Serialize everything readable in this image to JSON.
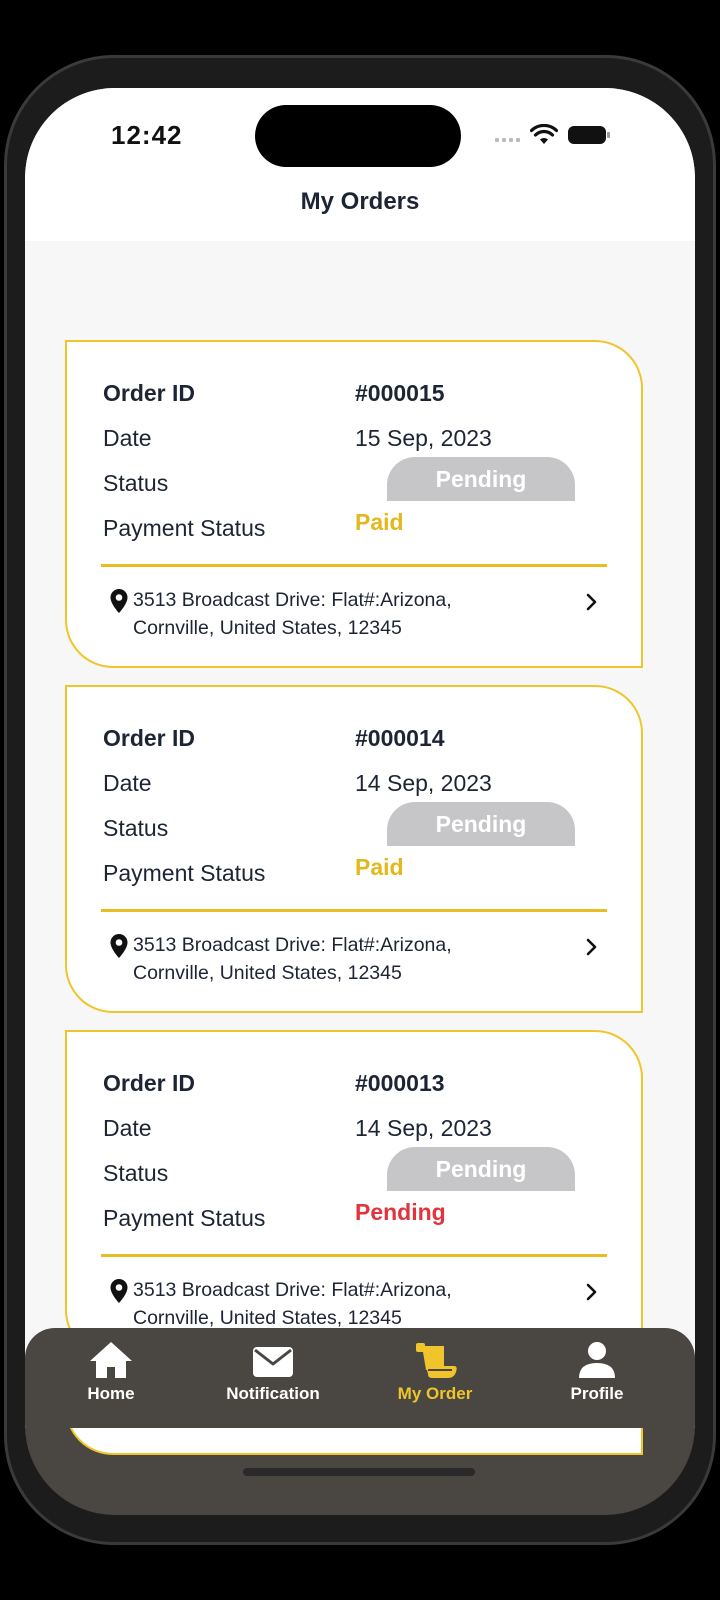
{
  "status_bar": {
    "time": "12:42"
  },
  "header": {
    "title": "My Orders"
  },
  "labels": {
    "order_id": "Order ID",
    "date": "Date",
    "status": "Status",
    "payment_status": "Payment Status"
  },
  "orders": [
    {
      "id": "#000015",
      "date": "15 Sep, 2023",
      "status": "Pending",
      "payment_status": "Paid",
      "address_line1": "3513 Broadcast Drive:  Flat#:Arizona,",
      "address_line2": "Cornville, United States, 12345"
    },
    {
      "id": "#000014",
      "date": "14 Sep, 2023",
      "status": "Pending",
      "payment_status": "Paid",
      "address_line1": "3513 Broadcast Drive:  Flat#:Arizona,",
      "address_line2": "Cornville, United States, 12345"
    },
    {
      "id": "#000013",
      "date": "14 Sep, 2023",
      "status": "Pending",
      "payment_status": "Pending",
      "address_line1": "3513 Broadcast Drive:  Flat#:Arizona,",
      "address_line2": "Cornville, United States, 12345"
    }
  ],
  "nav": {
    "items": [
      {
        "label": "Home",
        "icon": "home-icon"
      },
      {
        "label": "Notification",
        "icon": "envelope-icon"
      },
      {
        "label": "My Order",
        "icon": "scroll-icon",
        "active": true
      },
      {
        "label": "Profile",
        "icon": "user-icon"
      }
    ]
  },
  "colors": {
    "accent": "#efc52b",
    "paid": "#e3b81c",
    "unpaid": "#e3343c",
    "badge": "#c6c6c8",
    "nav_bg": "#4a4742"
  }
}
